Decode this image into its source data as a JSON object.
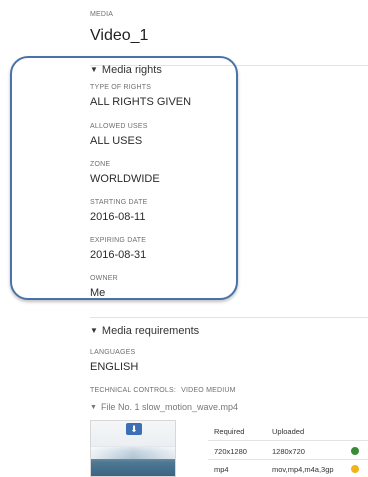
{
  "header": {
    "section_label": "MEDIA",
    "title": "Video_1"
  },
  "media_rights": {
    "heading": "Media rights",
    "fields": [
      {
        "label": "TYPE OF RIGHTS",
        "value": "ALL RIGHTS GIVEN"
      },
      {
        "label": "ALLOWED USES",
        "value": "ALL USES"
      },
      {
        "label": "ZONE",
        "value": "WORLDWIDE"
      },
      {
        "label": "STARTING DATE",
        "value": "2016-08-11"
      },
      {
        "label": "EXPIRING DATE",
        "value": "2016-08-31"
      },
      {
        "label": "OWNER",
        "value": "Me"
      }
    ]
  },
  "media_requirements": {
    "heading": "Media requirements",
    "languages_label": "LANGUAGES",
    "languages_value": "ENGLISH",
    "technical_controls_label": "TECHNICAL CONTROLS:",
    "technical_controls_value": "VIDEO MEDIUM",
    "file_heading": "File No. 1 slow_motion_wave.mp4",
    "table": {
      "headers": [
        "Required",
        "Uploaded"
      ],
      "rows": [
        {
          "required": "720x1280",
          "uploaded": "1280x720",
          "status": "ok"
        },
        {
          "required": "mp4",
          "uploaded": "mov,mp4,m4a,3gp",
          "status": "warning"
        }
      ]
    }
  },
  "colors": {
    "annotation_border": "#4a72a8",
    "status_ok": "#3a8a3a",
    "status_warning": "#f2b21b",
    "download_icon": "#3b6fb6"
  },
  "icons": {
    "section_toggle": "triangle-down-icon",
    "thumbnail_action": "download-icon",
    "row_ok": "check-circle-icon",
    "row_warning": "warning-circle-icon"
  }
}
